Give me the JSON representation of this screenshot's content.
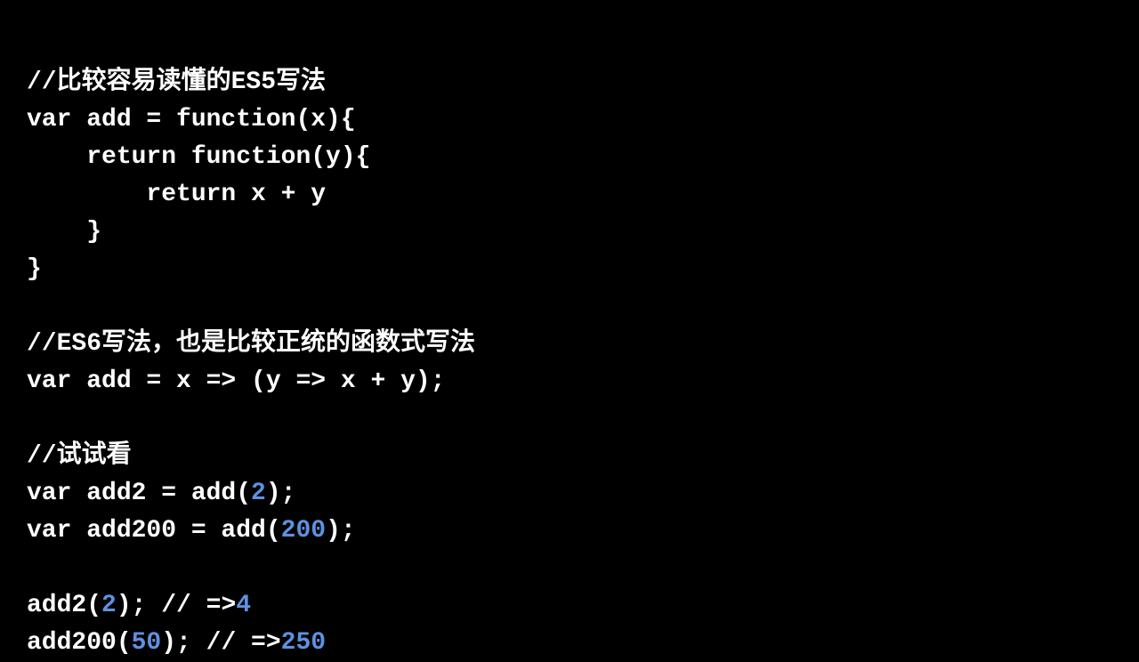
{
  "code": {
    "line1_comment": "//比较容易读懂的ES5写法",
    "line2_a": "var add = function(x){",
    "line3_a": "    return function(y){",
    "line4_a": "        return x + y",
    "line5_a": "    }",
    "line6_a": "}",
    "line8_comment": "//ES6写法，也是比较正统的函数式写法",
    "line9_a": "var add = x => (y => x + y);",
    "line11_comment": "//试试看",
    "line12_a": "var add2 = add(",
    "line12_num": "2",
    "line12_b": ");",
    "line13_a": "var add200 = add(",
    "line13_num": "200",
    "line13_b": ");",
    "line15_a": "add2(",
    "line15_num1": "2",
    "line15_b": "); // =>",
    "line15_num2": "4",
    "line16_a": "add200(",
    "line16_num1": "50",
    "line16_b": "); // =>",
    "line16_num2": "250"
  }
}
